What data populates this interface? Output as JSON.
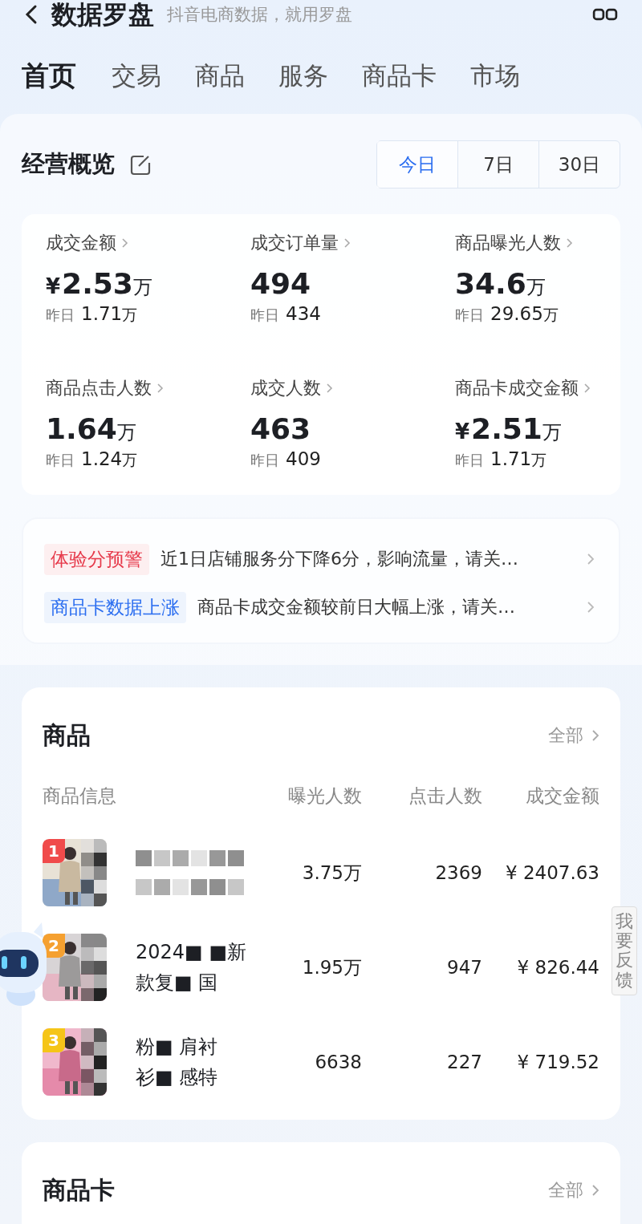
{
  "header": {
    "title": "数据罗盘",
    "subtitle": "抖音电商数据，就用罗盘"
  },
  "tabs": [
    {
      "label": "首页",
      "selected": true
    },
    {
      "label": "交易",
      "selected": false
    },
    {
      "label": "商品",
      "selected": false
    },
    {
      "label": "服务",
      "selected": false
    },
    {
      "label": "商品卡",
      "selected": false
    },
    {
      "label": "市场",
      "selected": false
    }
  ],
  "overview": {
    "title": "经营概览",
    "periods": [
      {
        "label": "今日",
        "selected": true
      },
      {
        "label": "7日",
        "selected": false
      },
      {
        "label": "30日",
        "selected": false
      }
    ],
    "metrics": [
      {
        "label": "成交金额",
        "currency": "¥",
        "value": "2.53",
        "unit": "万",
        "compare_label": "昨日",
        "compare_value": "1.71",
        "compare_unit": "万"
      },
      {
        "label": "成交订单量",
        "value": "494",
        "compare_label": "昨日",
        "compare_value": "434"
      },
      {
        "label": "商品曝光人数",
        "value": "34.6",
        "unit": "万",
        "compare_label": "昨日",
        "compare_value": "29.65",
        "compare_unit": "万"
      },
      {
        "label": "商品点击人数",
        "value": "1.64",
        "unit": "万",
        "compare_label": "昨日",
        "compare_value": "1.24",
        "compare_unit": "万"
      },
      {
        "label": "成交人数",
        "value": "463",
        "compare_label": "昨日",
        "compare_value": "409"
      },
      {
        "label": "商品卡成交金额",
        "currency": "¥",
        "value": "2.51",
        "unit": "万",
        "compare_label": "昨日",
        "compare_value": "1.71",
        "compare_unit": "万"
      }
    ]
  },
  "alerts": [
    {
      "kind": "warning",
      "tag": "体验分预警",
      "text": "近1日店铺服务分下降6分，影响流量，请关…"
    },
    {
      "kind": "info",
      "tag": "商品卡数据上涨",
      "text": "商品卡成交金额较前日大幅上涨，请关…"
    }
  ],
  "products": {
    "title": "商品",
    "more": "全部",
    "columns": [
      "商品信息",
      "曝光人数",
      "点击人数",
      "成交金额"
    ],
    "rows": [
      {
        "rank": "1",
        "color": "#f04b4b",
        "exposure": "3.75万",
        "clicks": "2369",
        "amount": "¥ 2407.63"
      },
      {
        "rank": "2",
        "color": "#f5a030",
        "name_lines": [
          "2024■ ■新",
          "款复■ 国"
        ],
        "exposure": "1.95万",
        "clicks": "947",
        "amount": "¥ 826.44"
      },
      {
        "rank": "3",
        "color": "#f5c518",
        "name_lines": [
          "粉■ 肩衬",
          "衫■ 感特"
        ],
        "exposure": "6638",
        "clicks": "227",
        "amount": "¥ 719.52"
      }
    ]
  },
  "product_cards": {
    "title": "商品卡",
    "more": "全部"
  },
  "feedback": "我要反馈"
}
